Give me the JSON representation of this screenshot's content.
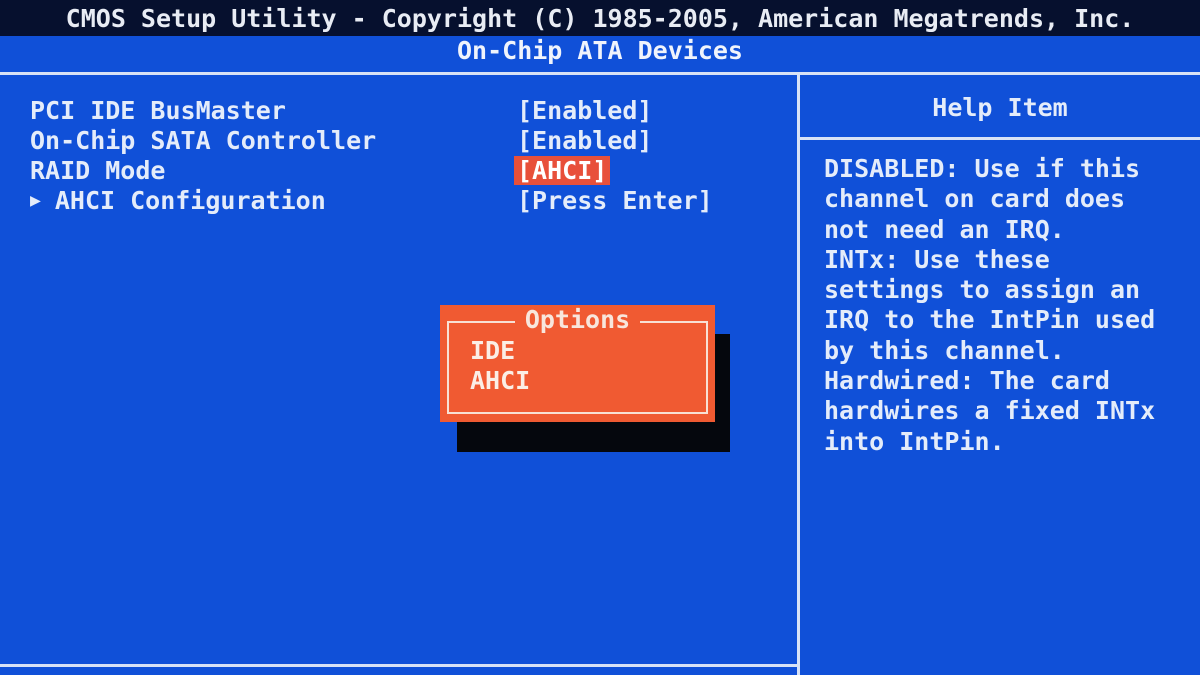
{
  "header": {
    "title": "CMOS Setup Utility - Copyright (C) 1985-2005, American Megatrends, Inc.",
    "subtitle": "On-Chip ATA Devices"
  },
  "settings": [
    {
      "label": "PCI IDE BusMaster",
      "value": "[Enabled]"
    },
    {
      "label": "On-Chip SATA Controller",
      "value": "[Enabled]"
    },
    {
      "label": "RAID Mode",
      "value": "[AHCI]"
    },
    {
      "label": "AHCI Configuration",
      "value": "[Press Enter]"
    }
  ],
  "help": {
    "title": "Help Item",
    "lines": [
      "DISABLED: Use if this",
      "channel on card does",
      "not need an IRQ.",
      "INTx: Use these",
      "settings to assign an",
      "IRQ to the IntPin used",
      "by this channel.",
      "Hardwired: The card",
      "hardwires a fixed INTx",
      "into IntPin."
    ]
  },
  "popup": {
    "title": "Options",
    "options": [
      "IDE",
      "AHCI"
    ]
  },
  "colors": {
    "background": "#1050d8",
    "highlight": "#e8503a",
    "popup": "#f05a32",
    "text": "#e4ecfa"
  }
}
